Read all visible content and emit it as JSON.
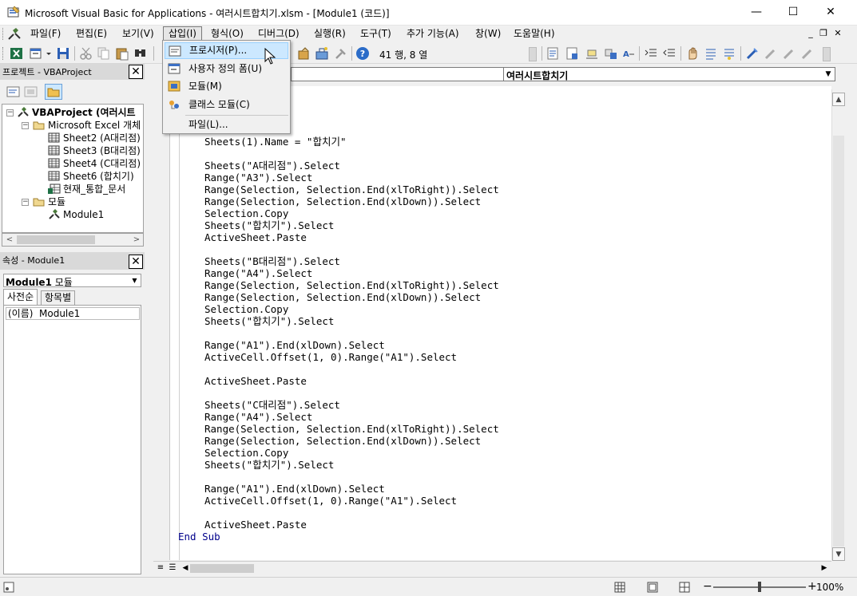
{
  "window": {
    "title": "Microsoft Visual Basic for Applications - 여러시트합치기.xlsm - [Module1 (코드)]"
  },
  "menu": {
    "items": [
      {
        "label": "파일(F)"
      },
      {
        "label": "편집(E)"
      },
      {
        "label": "보기(V)"
      },
      {
        "label": "삽입(I)"
      },
      {
        "label": "형식(O)"
      },
      {
        "label": "디버그(D)"
      },
      {
        "label": "실행(R)"
      },
      {
        "label": "도구(T)"
      },
      {
        "label": "추가 기능(A)"
      },
      {
        "label": "창(W)"
      },
      {
        "label": "도움말(H)"
      }
    ]
  },
  "toolbar": {
    "position_text": "41 행, 8 열"
  },
  "insert_menu": {
    "items": [
      {
        "label": "프로시저(P)..."
      },
      {
        "label": "사용자 정의 폼(U)"
      },
      {
        "label": "모듈(M)"
      },
      {
        "label": "클래스 모듈(C)"
      },
      {
        "label": "파일(L)..."
      }
    ]
  },
  "project": {
    "title": "프로젝트 - VBAProject",
    "tree": [
      {
        "label": "VBAProject (여러시트"
      },
      {
        "label": "Microsoft Excel 개체"
      },
      {
        "label": "Sheet2 (A대리점)"
      },
      {
        "label": "Sheet3 (B대리점)"
      },
      {
        "label": "Sheet4 (C대리점)"
      },
      {
        "label": "Sheet6 (합치기)"
      },
      {
        "label": "현재_통합_문서"
      },
      {
        "label": "모듈"
      },
      {
        "label": "Module1"
      }
    ]
  },
  "properties": {
    "title": "속성 - Module1",
    "object_name": "Module1",
    "object_type": "모듈",
    "tabs": [
      {
        "label": "사전순"
      },
      {
        "label": "항목별"
      }
    ],
    "rows": [
      {
        "key": "(이름)",
        "value": "Module1"
      }
    ]
  },
  "code": {
    "procedure_combo": "여러시트합치기",
    "lines": [
      "Sheets(1).Name = \"합치기\"",
      "",
      "Sheets(\"A대리점\").Select",
      "Range(\"A3\").Select",
      "Range(Selection, Selection.End(xlToRight)).Select",
      "Range(Selection, Selection.End(xlDown)).Select",
      "Selection.Copy",
      "Sheets(\"합치기\").Select",
      "ActiveSheet.Paste",
      "",
      "Sheets(\"B대리점\").Select",
      "Range(\"A4\").Select",
      "Range(Selection, Selection.End(xlToRight)).Select",
      "Range(Selection, Selection.End(xlDown)).Select",
      "Selection.Copy",
      "Sheets(\"합치기\").Select",
      "",
      "Range(\"A1\").End(xlDown).Select",
      "ActiveCell.Offset(1, 0).Range(\"A1\").Select",
      "",
      "ActiveSheet.Paste",
      "",
      "Sheets(\"C대리점\").Select",
      "Range(\"A4\").Select",
      "Range(Selection, Selection.End(xlToRight)).Select",
      "Range(Selection, Selection.End(xlDown)).Select",
      "Selection.Copy",
      "Sheets(\"합치기\").Select",
      "",
      "Range(\"A1\").End(xlDown).Select",
      "ActiveCell.Offset(1, 0).Range(\"A1\").Select",
      "",
      "ActiveSheet.Paste"
    ],
    "end_line": "End Sub"
  },
  "statusbar": {
    "zoom": "100%",
    "zoom_fraction": 0.5
  }
}
